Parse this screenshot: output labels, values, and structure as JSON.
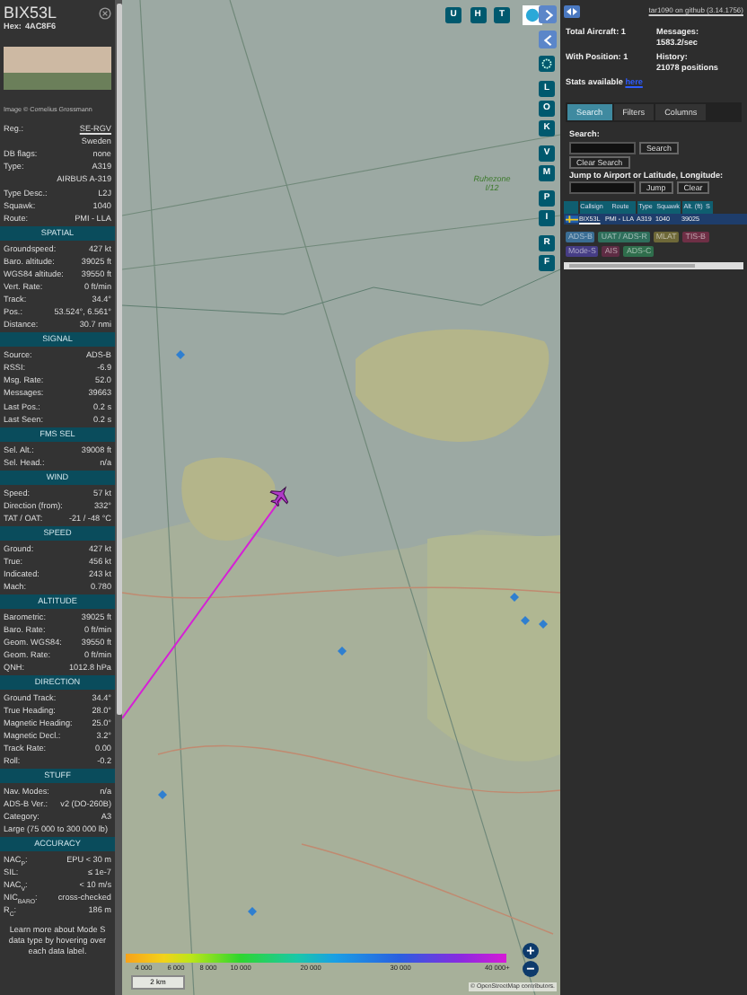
{
  "aircraft_panel": {
    "callsign": "BIX53L",
    "hex_label": "Hex:",
    "hex": "4AC8F6",
    "photo_credit": "Image © Cornelius Grossmann",
    "groups": [
      [
        {
          "kind": "link",
          "label": "Reg.:",
          "value": "SE-RGV"
        },
        {
          "kind": "value",
          "value": "Sweden"
        },
        {
          "kind": "pair",
          "label": "DB flags:",
          "value": "none"
        },
        {
          "kind": "pair",
          "label": "Type:",
          "value": "A319"
        },
        {
          "kind": "value",
          "value": "AIRBUS A-319"
        }
      ],
      [
        {
          "kind": "pair",
          "label": "Type Desc.:",
          "value": "L2J"
        },
        {
          "kind": "pair",
          "label": "Squawk:",
          "value": "1040"
        },
        {
          "kind": "pair",
          "label": "Route:",
          "value": "PMI - LLA"
        }
      ]
    ],
    "sections": [
      {
        "title": "SPATIAL",
        "groups": [
          [
            {
              "kind": "pair",
              "label": "Groundspeed:",
              "value": "427 kt"
            },
            {
              "kind": "pair",
              "label": "Baro. altitude:",
              "value": "39025 ft"
            },
            {
              "kind": "pair",
              "label": "WGS84 altitude:",
              "value": "39550 ft"
            },
            {
              "kind": "pair",
              "label": "Vert. Rate:",
              "value": "0 ft/min"
            },
            {
              "kind": "pair",
              "label": "Track:",
              "value": "34.4°"
            },
            {
              "kind": "pair",
              "label": "Pos.:",
              "value": "53.524°, 6.561°"
            },
            {
              "kind": "pair",
              "label": "Distance:",
              "value": "30.7 nmi"
            }
          ]
        ]
      },
      {
        "title": "SIGNAL",
        "groups": [
          [
            {
              "kind": "pair",
              "label": "Source:",
              "value": "ADS-B"
            },
            {
              "kind": "pair",
              "label": "RSSI:",
              "value": "-6.9"
            },
            {
              "kind": "pair",
              "label": "Msg. Rate:",
              "value": "52.0"
            },
            {
              "kind": "pair",
              "label": "Messages:",
              "value": "39663"
            }
          ],
          [
            {
              "kind": "pair",
              "label": "Last Pos.:",
              "value": "0.2 s"
            },
            {
              "kind": "pair",
              "label": "Last Seen:",
              "value": "0.2 s"
            }
          ]
        ]
      },
      {
        "title": "FMS SEL",
        "groups": [
          [
            {
              "kind": "pair",
              "label": "Sel. Alt.:",
              "value": "39008 ft"
            },
            {
              "kind": "pair",
              "label": "Sel. Head.:",
              "value": "n/a"
            }
          ]
        ]
      },
      {
        "title": "WIND",
        "groups": [
          [
            {
              "kind": "pair",
              "label": "Speed:",
              "value": "57 kt"
            },
            {
              "kind": "pair",
              "label": "Direction (from):",
              "value": "332°"
            },
            {
              "kind": "pair",
              "label": "TAT / OAT:",
              "value": "-21 / -48 °C"
            }
          ]
        ]
      },
      {
        "title": "SPEED",
        "groups": [
          [
            {
              "kind": "pair",
              "label": "Ground:",
              "value": "427 kt"
            },
            {
              "kind": "pair",
              "label": "True:",
              "value": "456 kt"
            },
            {
              "kind": "pair",
              "label": "Indicated:",
              "value": "243 kt"
            },
            {
              "kind": "pair",
              "label": "Mach:",
              "value": "0.780"
            }
          ]
        ]
      },
      {
        "title": "ALTITUDE",
        "groups": [
          [
            {
              "kind": "pair",
              "label": "Barometric:",
              "value": "39025 ft"
            },
            {
              "kind": "pair",
              "label": "Baro. Rate:",
              "value": "0 ft/min"
            },
            {
              "kind": "pair",
              "label": "Geom. WGS84:",
              "value": "39550 ft"
            },
            {
              "kind": "pair",
              "label": "Geom. Rate:",
              "value": "0 ft/min"
            },
            {
              "kind": "pair",
              "label": "QNH:",
              "value": "1012.8 hPa"
            }
          ]
        ]
      },
      {
        "title": "DIRECTION",
        "groups": [
          [
            {
              "kind": "pair",
              "label": "Ground Track:",
              "value": "34.4°"
            },
            {
              "kind": "pair",
              "label": "True Heading:",
              "value": "28.0°"
            },
            {
              "kind": "pair",
              "label": "Magnetic Heading:",
              "value": "25.0°"
            },
            {
              "kind": "pair",
              "label": "Magnetic Decl.:",
              "value": "3.2°"
            },
            {
              "kind": "pair",
              "label": "Track Rate:",
              "value": "0.00"
            },
            {
              "kind": "pair",
              "label": "Roll:",
              "value": "-0.2"
            }
          ]
        ]
      },
      {
        "title": "STUFF",
        "groups": [
          [
            {
              "kind": "pair",
              "label": "Nav. Modes:",
              "value": "n/a"
            },
            {
              "kind": "pair",
              "label": "ADS-B Ver.:",
              "value": "v2 (DO-260B)"
            },
            {
              "kind": "pair",
              "label": "Category:",
              "value": "A3"
            },
            {
              "kind": "note",
              "value": "Large (75 000 to 300 000 lb)"
            }
          ]
        ]
      },
      {
        "title": "ACCURACY",
        "groups": [
          [
            {
              "kind": "pair",
              "label": "NAC$_{P}$:",
              "value": "EPU < 30 m"
            },
            {
              "kind": "pair",
              "label": "SIL:",
              "value": "≤ 1e-7"
            },
            {
              "kind": "pair",
              "label": "NAC$_{V}$:",
              "value": "< 10 m/s"
            },
            {
              "kind": "pair",
              "label": "NIC$_{BARO}$:",
              "value": "cross-checked"
            },
            {
              "kind": "pair",
              "label": "R$_{C}$:",
              "value": "186 m"
            }
          ]
        ]
      }
    ],
    "footer": "Learn more about Mode S data type by hovering over each data label."
  },
  "map": {
    "layer_buttons": [
      "U",
      "H",
      "T"
    ],
    "side_button_groups": [
      [
        "L",
        "O",
        "K"
      ],
      [
        "V",
        "M"
      ],
      [
        "P",
        "I"
      ],
      [
        "R",
        "F"
      ]
    ],
    "zone_label": "Ruhezone I/12",
    "altitude_scale": [
      "4 000",
      "6 000",
      "8 000",
      "10 000",
      "20 000",
      "30 000",
      "40 000+"
    ],
    "scale_label": "2 km",
    "zoom_buttons": [
      "+",
      "−"
    ],
    "attribution": "© OpenStreetMap contributors."
  },
  "right_panel": {
    "version_link": "tar1090 on github (3.14.1756)",
    "stats": [
      {
        "label": "Total Aircraft:",
        "value": "1"
      },
      {
        "label": "Messages:",
        "value": "1583.2/sec"
      },
      {
        "label": "With Position:",
        "value": "1"
      },
      {
        "label": "History:",
        "value": "21078 positions"
      }
    ],
    "stats_note": "Stats available",
    "stats_link": "here",
    "tabs": [
      {
        "label": "Search",
        "selected": true
      },
      {
        "label": "Filters",
        "selected": false
      },
      {
        "label": "Columns",
        "selected": false
      }
    ],
    "search": {
      "label": "Search:",
      "button": "Search",
      "clear_button": "Clear Search"
    },
    "jump": {
      "label": "Jump to Airport or Latitude, Longitude:",
      "button": "Jump",
      "clear_button": "Clear"
    },
    "table": {
      "columns": [
        "Callsign",
        "Route",
        "Type",
        "Squawk",
        "Alt. (ft)",
        "S"
      ],
      "rows": [
        {
          "selected": true,
          "cells": [
            "BIX53L",
            "PMI - LLA",
            "A319",
            "1040",
            "39025"
          ]
        }
      ]
    },
    "legend": [
      {
        "label": "ADS-B",
        "color": "#3a6d94"
      },
      {
        "label": "UAT / ADS-R",
        "color": "#2f6f5c"
      },
      {
        "label": "MLAT",
        "color": "#6e6838"
      },
      {
        "label": "TIS-B",
        "color": "#6e2f45"
      },
      {
        "label": "Mode-S",
        "color": "#463d85"
      },
      {
        "label": "AIS",
        "color": "#5e2c44"
      },
      {
        "label": "ADS-C",
        "color": "#2f6e4c"
      }
    ]
  }
}
